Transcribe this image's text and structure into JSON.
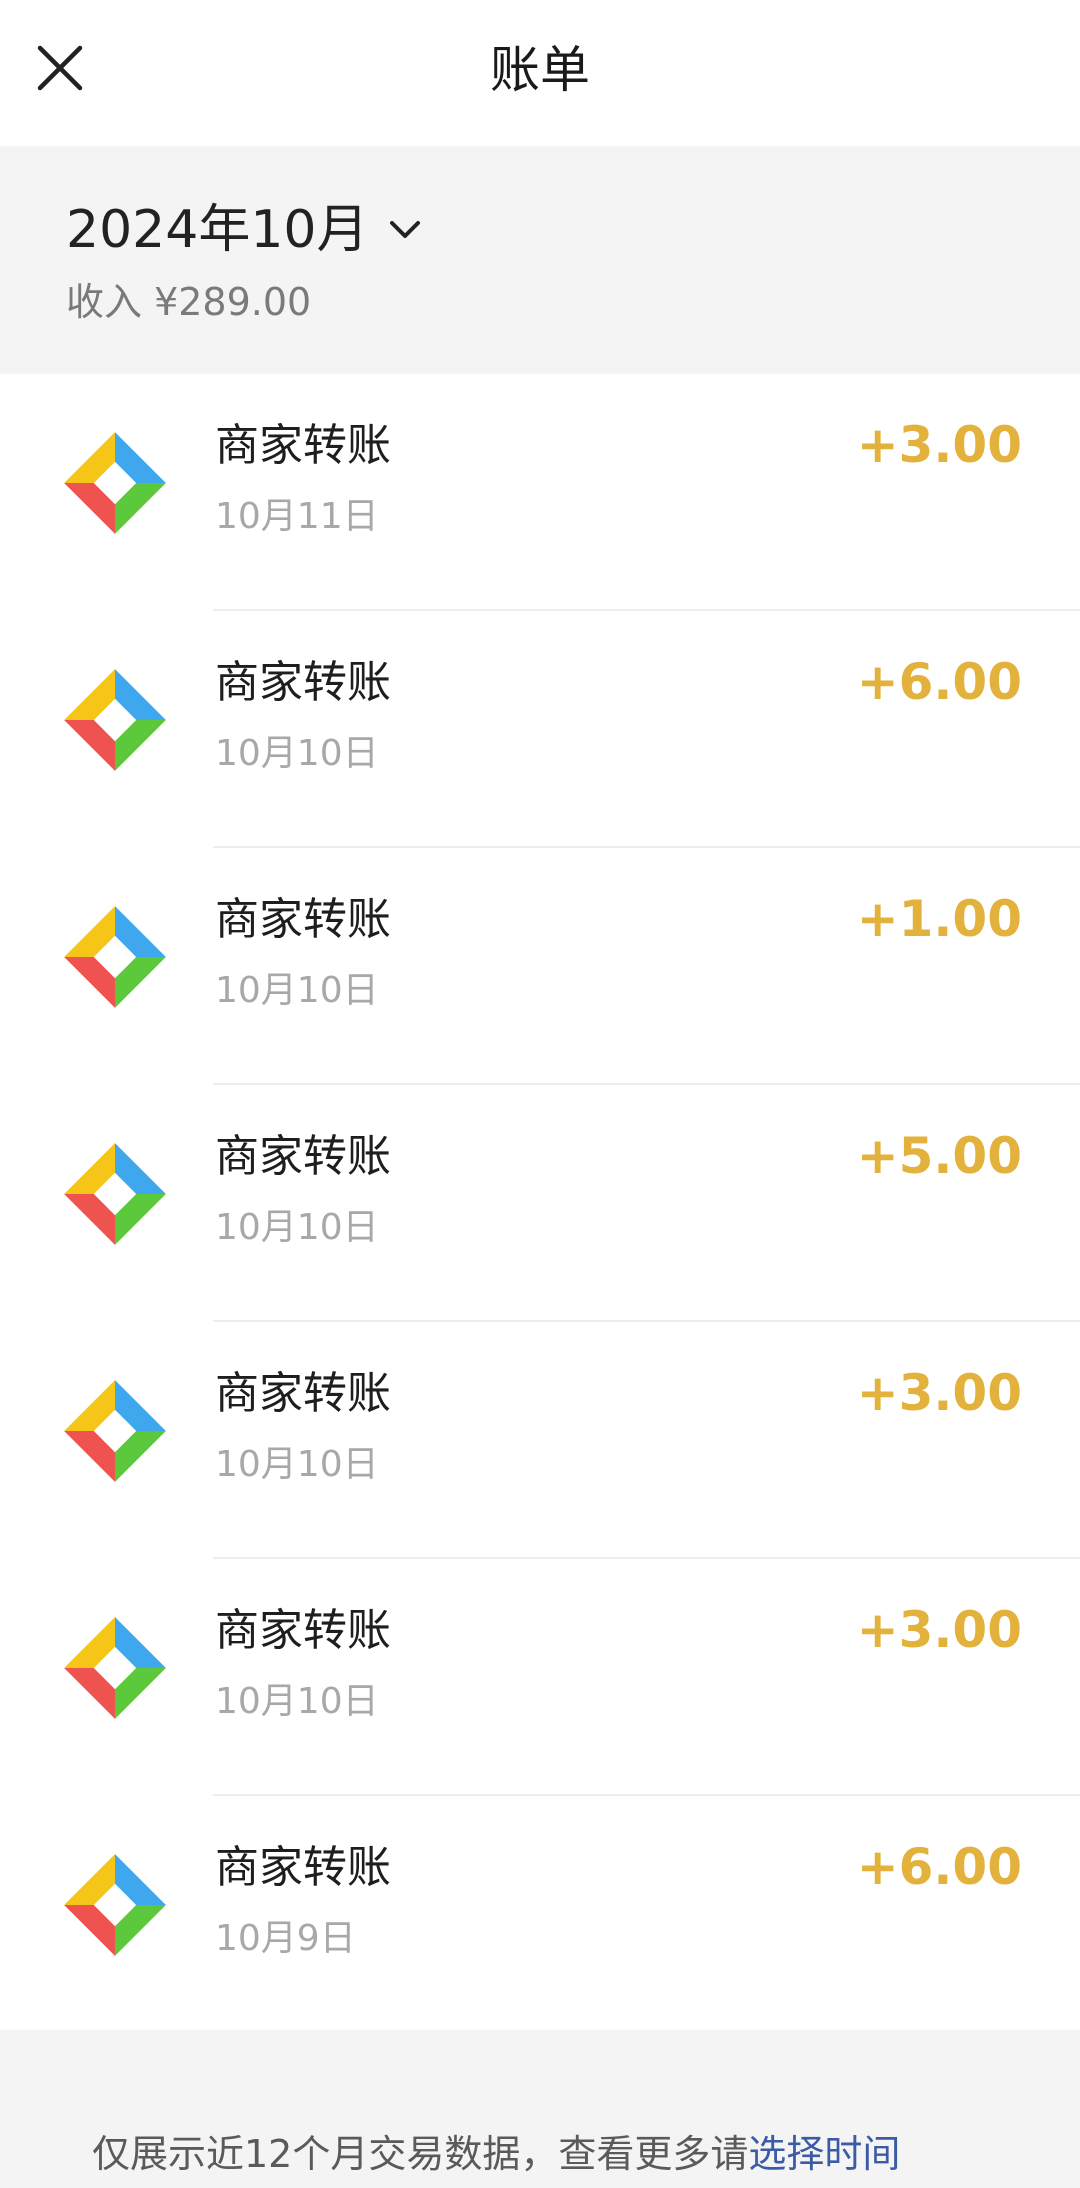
{
  "header": {
    "title": "账单"
  },
  "summary": {
    "month": "2024年10月",
    "income": "收入 ¥289.00"
  },
  "transactions": [
    {
      "title": "商家转账",
      "date": "10月11日",
      "amount": "+3.00"
    },
    {
      "title": "商家转账",
      "date": "10月10日",
      "amount": "+6.00"
    },
    {
      "title": "商家转账",
      "date": "10月10日",
      "amount": "+1.00"
    },
    {
      "title": "商家转账",
      "date": "10月10日",
      "amount": "+5.00"
    },
    {
      "title": "商家转账",
      "date": "10月10日",
      "amount": "+3.00"
    },
    {
      "title": "商家转账",
      "date": "10月10日",
      "amount": "+3.00"
    },
    {
      "title": "商家转账",
      "date": "10月9日",
      "amount": "+6.00"
    }
  ],
  "footer": {
    "note": "仅展示近12个月交易数据，查看更多请",
    "link": "选择时间"
  },
  "colors": {
    "amount": "#e3b23c",
    "icon_yellow": "#f5c518",
    "icon_blue": "#3ea7ee",
    "icon_red": "#ef5350",
    "icon_green": "#5cc83b"
  }
}
